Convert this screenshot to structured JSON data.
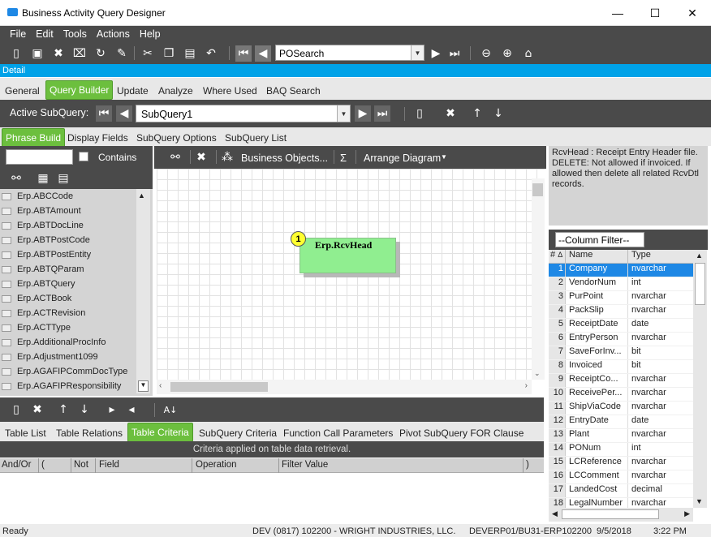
{
  "window": {
    "title": "Business Activity Query Designer"
  },
  "menu": [
    "File",
    "Edit",
    "Tools",
    "Actions",
    "Help"
  ],
  "toolbar": {
    "record_search": "POSearch"
  },
  "detail_label": "Detail",
  "main_tabs": [
    "General",
    "Query Builder",
    "Update",
    "Analyze",
    "Where Used",
    "BAQ Search"
  ],
  "active_main_tab": "Query Builder",
  "subquery": {
    "label": "Active SubQuery:",
    "value": "SubQuery1"
  },
  "sub_tabs": [
    "Phrase Build",
    "Display Fields",
    "SubQuery Options",
    "SubQuery List"
  ],
  "left_panel": {
    "contains_label": "Contains",
    "tables": [
      "Erp.ABCCode",
      "Erp.ABTAmount",
      "Erp.ABTDocLine",
      "Erp.ABTPostCode",
      "Erp.ABTPostEntity",
      "Erp.ABTQParam",
      "Erp.ABTQuery",
      "Erp.ACTBook",
      "Erp.ACTRevision",
      "Erp.ACTType",
      "Erp.AdditionalProcInfo",
      "Erp.Adjustment1099",
      "Erp.AGAFIPCommDocType",
      "Erp.AGAFIPResponsibility"
    ]
  },
  "diagram_toolbar": {
    "business_objects": "Business Objects...",
    "sigma": "Σ",
    "arrange": "Arrange Diagram"
  },
  "diagram": {
    "table_number": "1",
    "table_name": "Erp.RcvHead"
  },
  "description": "RcvHead : Receipt Entry Header file. DELETE: Not allowed if invoiced. If allowed then delete all related RcvDtl records.",
  "column_filter": "--Column Filter--",
  "columns_grid": {
    "headers": [
      "#",
      "Name",
      "Type"
    ],
    "rows": [
      {
        "n": "1",
        "name": "Company",
        "type": "nvarchar"
      },
      {
        "n": "2",
        "name": "VendorNum",
        "type": "int"
      },
      {
        "n": "3",
        "name": "PurPoint",
        "type": "nvarchar"
      },
      {
        "n": "4",
        "name": "PackSlip",
        "type": "nvarchar"
      },
      {
        "n": "5",
        "name": "ReceiptDate",
        "type": "date"
      },
      {
        "n": "6",
        "name": "EntryPerson",
        "type": "nvarchar"
      },
      {
        "n": "7",
        "name": "SaveForInv...",
        "type": "bit"
      },
      {
        "n": "8",
        "name": "Invoiced",
        "type": "bit"
      },
      {
        "n": "9",
        "name": "ReceiptCo...",
        "type": "nvarchar"
      },
      {
        "n": "10",
        "name": "ReceivePer...",
        "type": "nvarchar"
      },
      {
        "n": "11",
        "name": "ShipViaCode",
        "type": "nvarchar"
      },
      {
        "n": "12",
        "name": "EntryDate",
        "type": "date"
      },
      {
        "n": "13",
        "name": "Plant",
        "type": "nvarchar"
      },
      {
        "n": "14",
        "name": "PONum",
        "type": "int"
      },
      {
        "n": "15",
        "name": "LCReference",
        "type": "nvarchar"
      },
      {
        "n": "16",
        "name": "LCComment",
        "type": "nvarchar"
      },
      {
        "n": "17",
        "name": "LandedCost",
        "type": "decimal"
      },
      {
        "n": "18",
        "name": "LegalNumber",
        "type": "nvarchar"
      }
    ]
  },
  "bottom_tabs": [
    "Table List",
    "Table Relations",
    "Table Criteria",
    "SubQuery Criteria",
    "Function Call Parameters",
    "Pivot SubQuery FOR Clause"
  ],
  "active_bottom_tab": "Table Criteria",
  "criteria_caption": "Criteria applied on  table data retrieval.",
  "criteria_headers": [
    "And/Or",
    "(",
    "Not",
    "Field",
    "Operation",
    "Filter Value",
    ")"
  ],
  "status": {
    "ready": "Ready",
    "info": "DEV (0817) 102200 - WRIGHT INDUSTRIES, LLC.",
    "server": "DEVERP01/BU31-ERP102200",
    "date": "9/5/2018",
    "time": "3:22 PM"
  },
  "colors": {
    "accent_green": "#6cbf3e",
    "detail_blue": "#00a2e8",
    "dark_bar": "#4a4a4a",
    "table_green": "#90ee90",
    "selection": "#1e88e5"
  }
}
